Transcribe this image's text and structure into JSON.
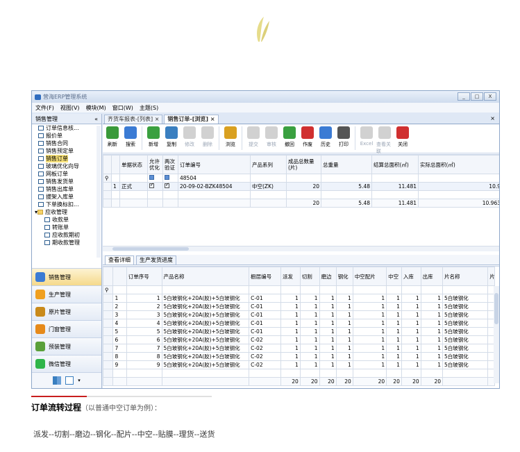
{
  "window": {
    "title": "营海ERP管理系统",
    "controls": [
      "_",
      "□",
      "X"
    ]
  },
  "menu": [
    "文件(F)",
    "视图(V)",
    "模块(M)",
    "窗口(W)",
    "主题(S)"
  ],
  "left_panel": {
    "title": "销售管理",
    "collapse": "«",
    "tree": [
      {
        "label": "订单信息核...",
        "indent": 0
      },
      {
        "label": "报价单",
        "indent": 0
      },
      {
        "label": "销售合同",
        "indent": 0
      },
      {
        "label": "销售预定单",
        "indent": 0
      },
      {
        "label": "销售订单",
        "indent": 0,
        "selected": true
      },
      {
        "label": "玻璃优化向导",
        "indent": 0
      },
      {
        "label": "网板订单",
        "indent": 0
      },
      {
        "label": "销售发货单",
        "indent": 0
      },
      {
        "label": "销售出库单",
        "indent": 0
      },
      {
        "label": "拔架入库单",
        "indent": 0
      },
      {
        "label": "下单换标扣...",
        "indent": 0
      },
      {
        "label": "应收管理",
        "indent": -1,
        "group": true
      },
      {
        "label": "收款单",
        "indent": 1
      },
      {
        "label": "转账单",
        "indent": 1
      },
      {
        "label": "应收款期初",
        "indent": 1
      },
      {
        "label": "期收款管理",
        "indent": 1
      }
    ],
    "nav": [
      {
        "label": "销售管理",
        "active": true,
        "color": "#3b7bd4"
      },
      {
        "label": "生产管理",
        "color": "#f0a020"
      },
      {
        "label": "原片管理",
        "color": "#c98a1a"
      },
      {
        "label": "门窗管理",
        "color": "#e68a1a"
      },
      {
        "label": "预装管理",
        "color": "#5aa03a"
      },
      {
        "label": "微信管理",
        "color": "#2fb54a"
      }
    ]
  },
  "tabs": [
    {
      "label": "齐货车报表-[列表]",
      "active": false,
      "close": "×"
    },
    {
      "label": "销售订单-[浏览]",
      "active": true,
      "close": "×"
    }
  ],
  "tab_close_all": "×",
  "toolbar": [
    {
      "label": "刷新",
      "icon": "refresh-icon",
      "color": "#3a9a3a",
      "enabled": true
    },
    {
      "label": "搜索",
      "icon": "search-icon",
      "color": "#3b7bd4",
      "enabled": true
    },
    {
      "label": "新增",
      "icon": "add-icon",
      "color": "#3aa040",
      "enabled": true
    },
    {
      "label": "复制",
      "icon": "copy-icon",
      "color": "#3a7fc0",
      "enabled": true
    },
    {
      "label": "修改",
      "icon": "edit-icon",
      "color": "#7a7a7a",
      "enabled": false
    },
    {
      "label": "删除",
      "icon": "delete-icon",
      "color": "#7a7a7a",
      "enabled": false
    },
    {
      "label": "浏览",
      "icon": "browse-icon",
      "color": "#d9a020",
      "enabled": true
    },
    {
      "label": "提交",
      "icon": "submit-icon",
      "color": "#7a7a7a",
      "enabled": false
    },
    {
      "label": "审核",
      "icon": "audit-icon",
      "color": "#7a7a7a",
      "enabled": false
    },
    {
      "label": "撤回",
      "icon": "withdraw-icon",
      "color": "#3aa040",
      "enabled": true
    },
    {
      "label": "作废",
      "icon": "void-icon",
      "color": "#d03030",
      "enabled": true
    },
    {
      "label": "历史",
      "icon": "history-icon",
      "color": "#3b7bd4",
      "enabled": true
    },
    {
      "label": "打印",
      "icon": "print-icon",
      "color": "#555555",
      "enabled": true
    },
    {
      "label": "Excel",
      "icon": "excel-icon",
      "color": "#7a7a7a",
      "enabled": false
    },
    {
      "label": "查看关联",
      "icon": "related-icon",
      "color": "#7a7a7a",
      "enabled": false
    },
    {
      "label": "关闭",
      "icon": "power-icon",
      "color": "#d03030",
      "enabled": true
    }
  ],
  "order_grid": {
    "columns": [
      "单据状态",
      "允许优化",
      "两次验证",
      "订单编号",
      "产品系列",
      "成品总数量(片)",
      "总重量",
      "结算总面积(㎡)",
      "实际总面积(㎡)"
    ],
    "filter_row": {
      "order_no": "48504"
    },
    "rows": [
      {
        "row": "1",
        "status": "正式",
        "allow_opt": true,
        "verify": true,
        "order_no": "20-09-02-BZK48504",
        "series": "中空(ZK)",
        "qty": "20",
        "weight": "5.48",
        "settle_area": "11.481",
        "actual_area": "10.9"
      }
    ],
    "totals": {
      "qty": "20",
      "weight": "5.48",
      "settle_area": "11.481",
      "actual_area": "10.963"
    }
  },
  "sub_tabs": [
    {
      "label": "查看详细",
      "active": true
    },
    {
      "label": "生产发货进度",
      "active": false
    }
  ],
  "detail_grid": {
    "columns": [
      "订单序号",
      "产品名称",
      "橱层编号",
      "派发",
      "切割",
      "磨边",
      "钢化",
      "中空配片",
      "中空",
      "入库",
      "出库",
      "片名称",
      "片"
    ],
    "rows": [
      {
        "row": "1",
        "seq": "1",
        "name": "5白玻钢化+20A(胶)+5白玻钢化",
        "rack": "C-01",
        "v": [
          "1",
          "1",
          "1",
          "1",
          "1",
          "1",
          "1",
          "1"
        ],
        "piece": "5白玻钢化"
      },
      {
        "row": "2",
        "seq": "2",
        "name": "5白玻钢化+20A(胶)+5白玻钢化",
        "rack": "C-01",
        "v": [
          "1",
          "1",
          "1",
          "1",
          "1",
          "1",
          "1",
          "1"
        ],
        "piece": "5白玻钢化"
      },
      {
        "row": "3",
        "seq": "3",
        "name": "5白玻钢化+20A(胶)+5白玻钢化",
        "rack": "C-01",
        "v": [
          "1",
          "1",
          "1",
          "1",
          "1",
          "1",
          "1",
          "1"
        ],
        "piece": "5白玻钢化"
      },
      {
        "row": "4",
        "seq": "4",
        "name": "5白玻钢化+20A(胶)+5白玻钢化",
        "rack": "C-01",
        "v": [
          "1",
          "1",
          "1",
          "1",
          "1",
          "1",
          "1",
          "1"
        ],
        "piece": "5白玻钢化"
      },
      {
        "row": "5",
        "seq": "5",
        "name": "5白玻钢化+20A(胶)+5白玻钢化",
        "rack": "C-01",
        "v": [
          "1",
          "1",
          "1",
          "1",
          "1",
          "1",
          "1",
          "1"
        ],
        "piece": "5白玻钢化"
      },
      {
        "row": "6",
        "seq": "6",
        "name": "5白玻钢化+20A(胶)+5白玻钢化",
        "rack": "C-02",
        "v": [
          "1",
          "1",
          "1",
          "1",
          "1",
          "1",
          "1",
          "1"
        ],
        "piece": "5白玻钢化"
      },
      {
        "row": "7",
        "seq": "7",
        "name": "5白玻钢化+20A(胶)+5白玻钢化",
        "rack": "C-02",
        "v": [
          "1",
          "1",
          "1",
          "1",
          "1",
          "1",
          "1",
          "1"
        ],
        "piece": "5白玻钢化"
      },
      {
        "row": "8",
        "seq": "8",
        "name": "5白玻钢化+20A(胶)+5白玻钢化",
        "rack": "C-02",
        "v": [
          "1",
          "1",
          "1",
          "1",
          "1",
          "1",
          "1",
          "1"
        ],
        "piece": "5白玻钢化"
      },
      {
        "row": "9",
        "seq": "9",
        "name": "5白玻钢化+20A(胶)+5白玻钢化",
        "rack": "C-02",
        "v": [
          "1",
          "1",
          "1",
          "1",
          "1",
          "1",
          "1",
          "1"
        ],
        "piece": "5白玻钢化"
      }
    ],
    "totals": [
      "20",
      "20",
      "20",
      "20",
      "20",
      "20",
      "20",
      "20"
    ]
  },
  "article": {
    "heading_bold": "订单流转过程",
    "heading_note": "（以普通中空订单为例）：",
    "steps": "派发--切割--磨边--钢化--配片--中空--贴膜--理货--送货"
  }
}
